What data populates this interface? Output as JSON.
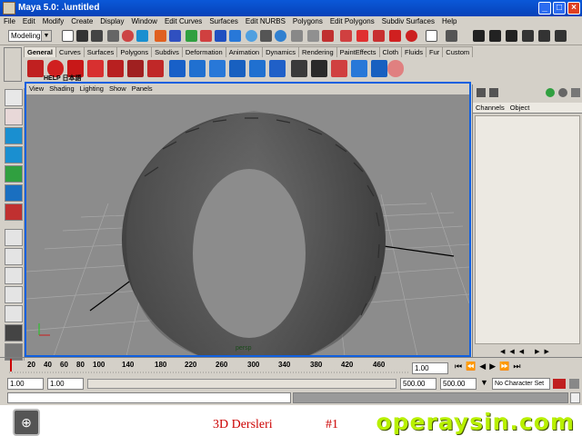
{
  "window": {
    "title": "Maya 5.0: .\\untitled",
    "minimize": "_",
    "maximize": "□",
    "close": "×"
  },
  "menu": [
    "File",
    "Edit",
    "Modify",
    "Create",
    "Display",
    "Window",
    "Edit Curves",
    "Surfaces",
    "Edit NURBS",
    "Polygons",
    "Edit Polygons",
    "Subdiv Surfaces",
    "Help"
  ],
  "toolbar": {
    "mode": "Modeling"
  },
  "shelf": {
    "tabs": [
      "General",
      "Curves",
      "Surfaces",
      "Polygons",
      "Subdivs",
      "Deformation",
      "Animation",
      "Dynamics",
      "Rendering",
      "PaintEffects",
      "Cloth",
      "Fluids",
      "Fur",
      "Custom"
    ],
    "help_label": "HELP 日本語"
  },
  "viewport": {
    "menu": [
      "View",
      "Shading",
      "Lighting",
      "Show",
      "Panels"
    ],
    "camera_label": "persp"
  },
  "channelbox": {
    "tabs": [
      "Channels",
      "Object"
    ]
  },
  "timeline": {
    "ticks": [
      "20",
      "40",
      "60",
      "80",
      "100",
      "140",
      "180",
      "220",
      "260",
      "300",
      "340",
      "380",
      "420",
      "460"
    ],
    "current_frame": "1.00"
  },
  "range": {
    "start": "1.00",
    "playback_start": "1.00",
    "playback_end": "500.00",
    "end": "500.00",
    "end2": "500.00",
    "character_set": "No Character Set"
  },
  "footer": {
    "caption": "3D Dersleri",
    "episode": "#1",
    "logo_text": "operaysin.com"
  },
  "colors": {
    "titlebar": "#0a58d8",
    "viewport_bg": "#8c8c8c",
    "caption": "#cc0000",
    "logo": "#b8f000"
  }
}
